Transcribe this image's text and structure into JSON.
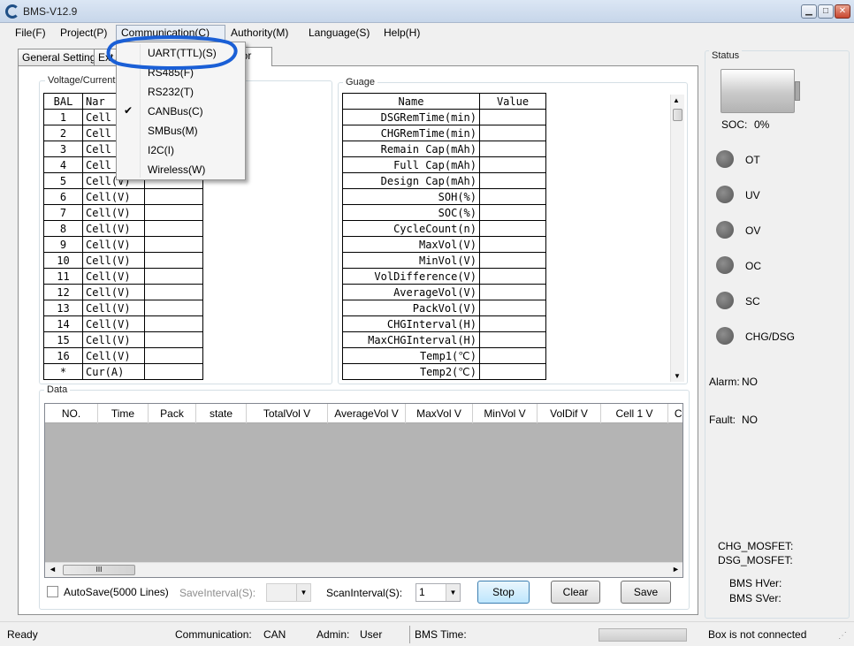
{
  "window": {
    "title": "BMS-V12.9"
  },
  "menubar": {
    "items": [
      "File(F)",
      "Project(P)",
      "Communication(C)",
      "Authority(M)",
      "Language(S)",
      "Help(H)"
    ]
  },
  "tabs": {
    "general": "General Setting",
    "ext": "Ext.",
    "monitor": "nitor"
  },
  "voltage_current": {
    "title": "Voltage/Current",
    "headers": [
      "BAL",
      "Nar"
    ],
    "rows": [
      [
        "1",
        "Cell"
      ],
      [
        "2",
        "Cell"
      ],
      [
        "3",
        "Cell"
      ],
      [
        "4",
        "Cell"
      ],
      [
        "5",
        "Cell(V)"
      ],
      [
        "6",
        "Cell(V)"
      ],
      [
        "7",
        "Cell(V)"
      ],
      [
        "8",
        "Cell(V)"
      ],
      [
        "9",
        "Cell(V)"
      ],
      [
        "10",
        "Cell(V)"
      ],
      [
        "11",
        "Cell(V)"
      ],
      [
        "12",
        "Cell(V)"
      ],
      [
        "13",
        "Cell(V)"
      ],
      [
        "14",
        "Cell(V)"
      ],
      [
        "15",
        "Cell(V)"
      ],
      [
        "16",
        "Cell(V)"
      ],
      [
        "*",
        "Cur(A)"
      ]
    ]
  },
  "gauge": {
    "title": "Guage",
    "headers": [
      "Name",
      "Value"
    ],
    "rows": [
      "DSGRemTime(min)",
      "CHGRemTime(min)",
      "Remain Cap(mAh)",
      "Full Cap(mAh)",
      "Design Cap(mAh)",
      "SOH(%)",
      "SOC(%)",
      "CycleCount(n)",
      "MaxVol(V)",
      "MinVol(V)",
      "VolDifference(V)",
      "AverageVol(V)",
      "PackVol(V)",
      "CHGInterval(H)",
      "MaxCHGInterval(H)",
      "Temp1(℃)",
      "Temp2(℃)"
    ]
  },
  "data_section": {
    "title": "Data",
    "columns": [
      "NO.",
      "Time",
      "Pack",
      "state",
      "TotalVol V",
      "AverageVol V",
      "MaxVol V",
      "MinVol V",
      "VolDif V",
      "Cell  1 V",
      "Ce"
    ],
    "scroll_grip": "III"
  },
  "controls": {
    "autosave_label": "AutoSave(5000 Lines)",
    "save_interval_label": "SaveInterval(S):",
    "scan_interval_label": "ScanInterval(S):",
    "scan_interval_value": "1",
    "stop": "Stop",
    "clear": "Clear",
    "save": "Save"
  },
  "status": {
    "title": "Status",
    "soc_label": "SOC:",
    "soc_value": "0%",
    "indicators": [
      "OT",
      "UV",
      "OV",
      "OC",
      "SC",
      "CHG/DSG"
    ],
    "alarm_label": "Alarm:",
    "alarm_value": "NO",
    "fault_label": "Fault:",
    "fault_value": "NO",
    "chg_mosfet": "CHG_MOSFET:",
    "dsg_mosfet": "DSG_MOSFET:",
    "bms_hver": "BMS HVer:",
    "bms_sver": "BMS SVer:"
  },
  "communication_menu": {
    "items": [
      "UART(TTL)(S)",
      "RS485(F)",
      "RS232(T)",
      "CANBus(C)",
      "SMBus(M)",
      "I2C(I)",
      "Wireless(W)"
    ],
    "checked": "CANBus(C)"
  },
  "statusbar": {
    "ready": "Ready",
    "communication_label": "Communication:",
    "communication_value": "CAN",
    "admin_label": "Admin:",
    "admin_value": "User",
    "bms_time_label": "BMS Time:",
    "box_status": "Box is not connected"
  },
  "colors": {
    "annotation_circle": "#1a5fd6",
    "led_off": "#7a7a7a"
  }
}
